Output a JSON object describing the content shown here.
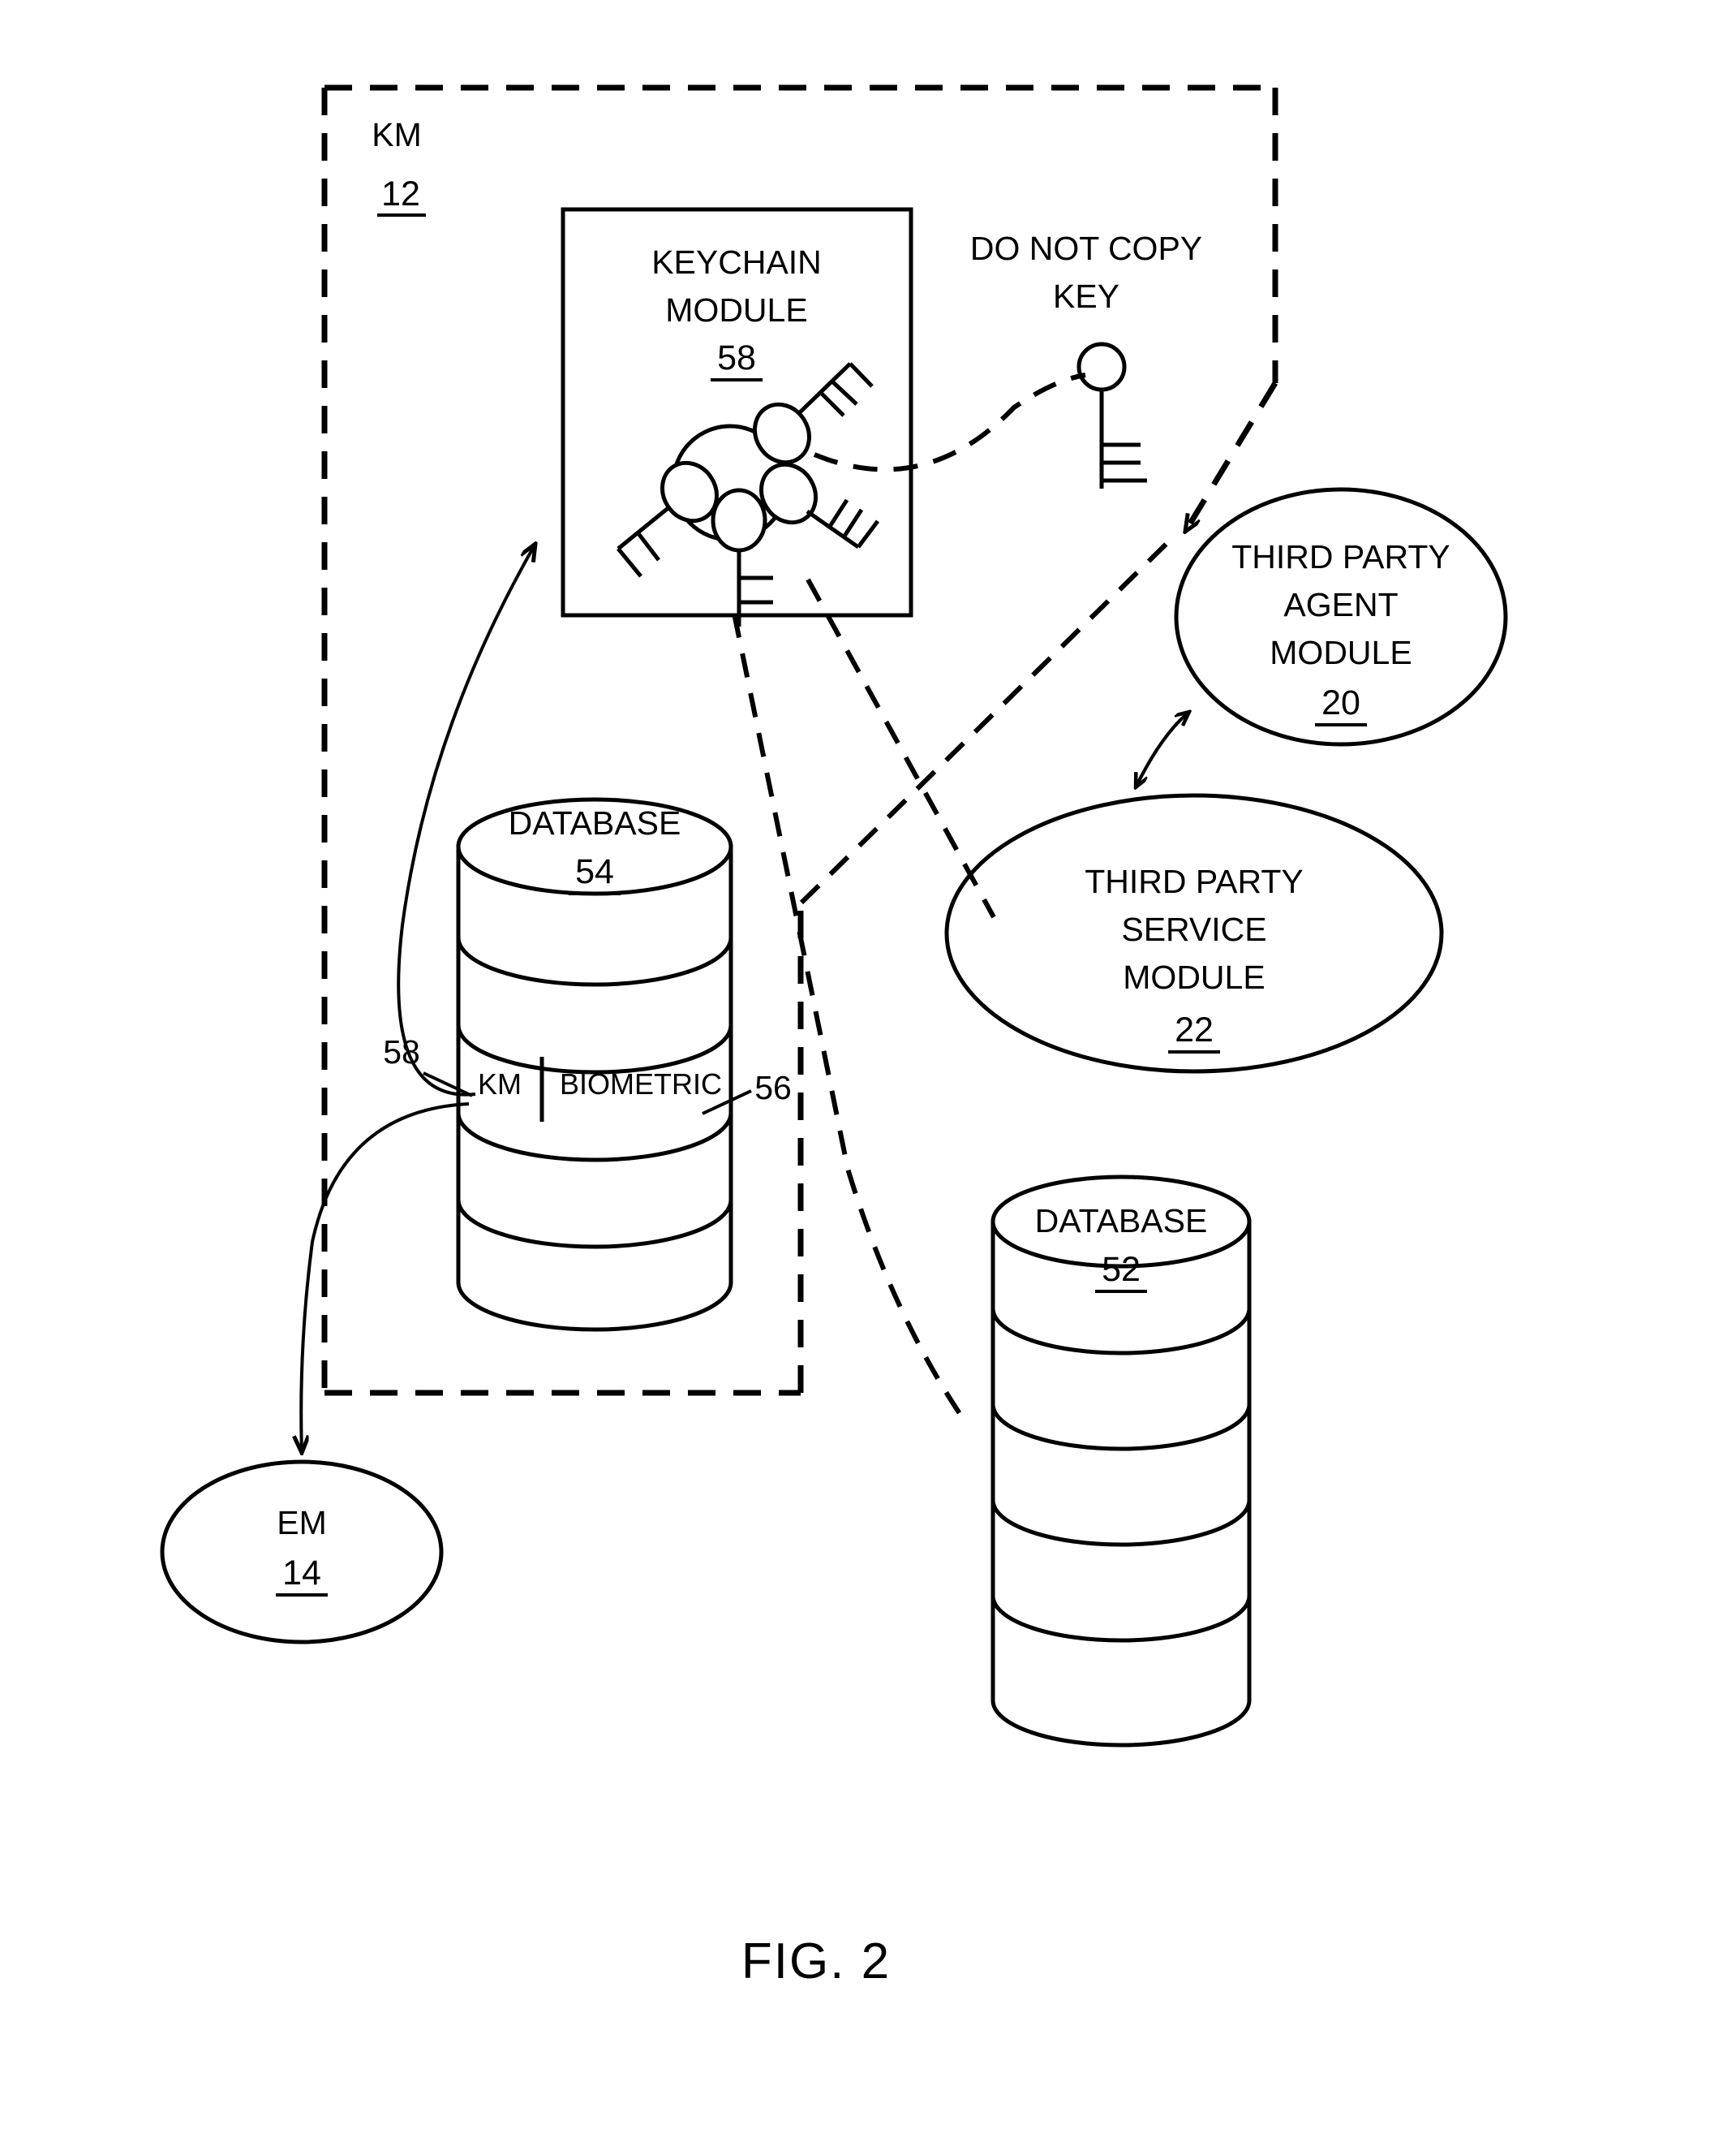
{
  "figure": {
    "caption": "FIG. 2"
  },
  "boundary": {
    "label": "KM",
    "ref": "12"
  },
  "keychain_module": {
    "line1": "KEYCHAIN",
    "line2": "MODULE",
    "ref": "58"
  },
  "do_not_copy_key": {
    "line1": "DO NOT COPY",
    "line2": "KEY"
  },
  "third_party_agent_module": {
    "line1": "THIRD PARTY",
    "line2": "AGENT",
    "line3": "MODULE",
    "ref": "20"
  },
  "third_party_service_module": {
    "line1": "THIRD PARTY",
    "line2": "SERVICE",
    "line3": "MODULE",
    "ref": "22"
  },
  "database_54": {
    "label": "DATABASE",
    "ref": "54",
    "segment_left": "KM",
    "segment_right": "BIOMETRIC",
    "callout_left_ref": "58",
    "callout_right_ref": "56"
  },
  "database_52": {
    "label": "DATABASE",
    "ref": "52"
  },
  "em_module": {
    "label": "EM",
    "ref": "14"
  },
  "colors": {
    "ink": "#000000",
    "paper": "#ffffff"
  }
}
